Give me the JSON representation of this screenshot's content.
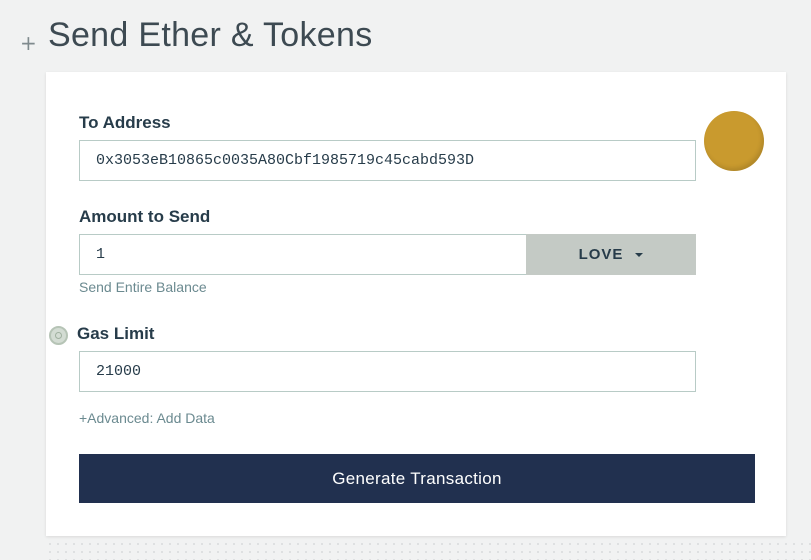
{
  "header": {
    "title": "Send Ether & Tokens",
    "plus_glyph": "+"
  },
  "form": {
    "to_address": {
      "label": "To Address",
      "value": "0x3053eB10865c0035A80Cbf1985719c45cabd593D",
      "identicon_color": "#c99a2e"
    },
    "amount": {
      "label": "Amount to Send",
      "value": "1",
      "unit": "LOVE",
      "send_entire_balance": "Send Entire Balance"
    },
    "gas": {
      "label": "Gas Limit",
      "value": "21000"
    },
    "advanced_link": "+Advanced: Add Data",
    "generate_button": "Generate Transaction"
  },
  "colors": {
    "primary_button": "#21304f",
    "label_text": "#273c4a",
    "link_text": "#6b8a90",
    "input_border": "#b8cbc6",
    "unit_button_bg": "#c4cac5"
  },
  "icons": [
    "plus-icon",
    "identicon",
    "help-icon",
    "caret-down-icon"
  ]
}
